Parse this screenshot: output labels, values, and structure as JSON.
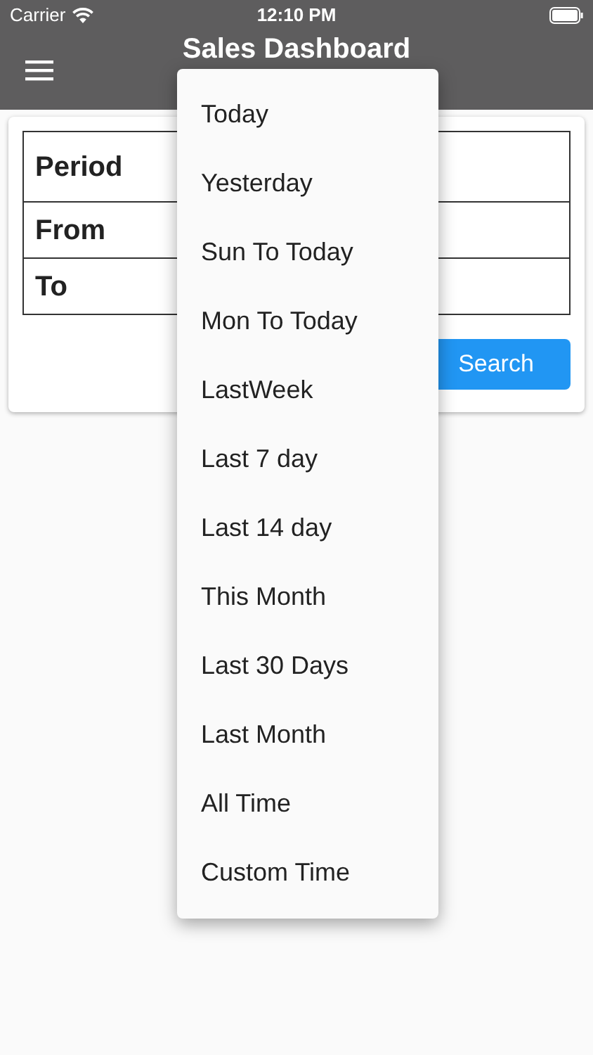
{
  "status_bar": {
    "carrier": "Carrier",
    "time": "12:10 PM"
  },
  "app_bar": {
    "title": "Sales Dashboard"
  },
  "form": {
    "rows": [
      {
        "label": "Period"
      },
      {
        "label": "From"
      },
      {
        "label": "To"
      }
    ],
    "search_button": "Search"
  },
  "menu": {
    "items": [
      {
        "label": "Today"
      },
      {
        "label": "Yesterday"
      },
      {
        "label": "Sun To Today"
      },
      {
        "label": "Mon To Today"
      },
      {
        "label": "LastWeek"
      },
      {
        "label": "Last 7 day"
      },
      {
        "label": "Last 14 day"
      },
      {
        "label": "This Month"
      },
      {
        "label": "Last 30 Days"
      },
      {
        "label": "Last Month"
      },
      {
        "label": "All Time"
      },
      {
        "label": "Custom Time"
      }
    ]
  }
}
